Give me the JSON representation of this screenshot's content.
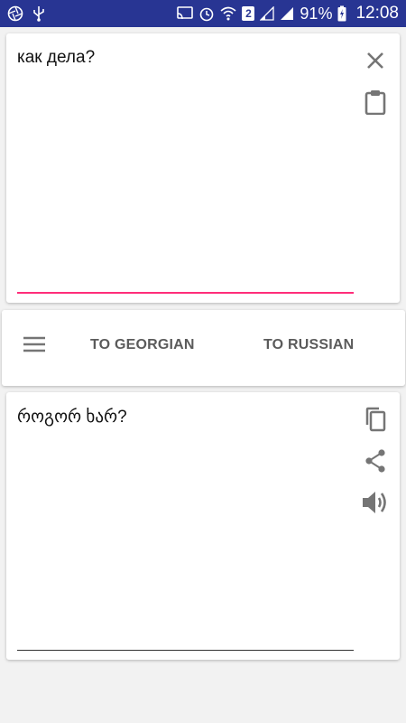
{
  "status_bar": {
    "sim_badge": "2",
    "battery_percent": "91%",
    "time": "12:08",
    "background": "#283593",
    "icons": [
      "aperture-icon",
      "usb-icon",
      "cast-icon",
      "alarm-icon",
      "wifi-icon",
      "sim2-badge-icon",
      "signal-icon",
      "signal-full-icon",
      "battery-charging-icon"
    ]
  },
  "input_card": {
    "text": "как дела?",
    "underline_color": "#ff2d7a",
    "icons": [
      "close-icon",
      "clipboard-icon"
    ]
  },
  "controls": {
    "menu_icon": "hamburger-menu-icon",
    "to_georgian_label": "TO GEORGIAN",
    "to_russian_label": "TO RUSSIAN"
  },
  "output_card": {
    "text": "როგორ ხარ?",
    "icons": [
      "copy-icon",
      "share-icon",
      "volume-icon"
    ]
  }
}
